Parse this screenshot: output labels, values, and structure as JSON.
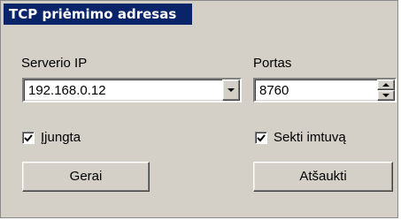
{
  "dialog": {
    "title": "TCP priėmimo adresas"
  },
  "server_ip": {
    "label": "Serverio IP",
    "value": "192.168.0.12"
  },
  "port": {
    "label": "Portas",
    "value": "8760"
  },
  "enabled_checkbox": {
    "label_first": "Į",
    "label_rest": "jungta",
    "checked": true
  },
  "follow_receiver_checkbox": {
    "label": "Sekti imtuvą",
    "checked": true
  },
  "buttons": {
    "ok": "Gerai",
    "cancel": "Atšaukti"
  },
  "icons": {
    "dropdown": "chevron-down-icon",
    "spinner": "spinner-arrows-icon",
    "check": "checkmark-icon"
  }
}
